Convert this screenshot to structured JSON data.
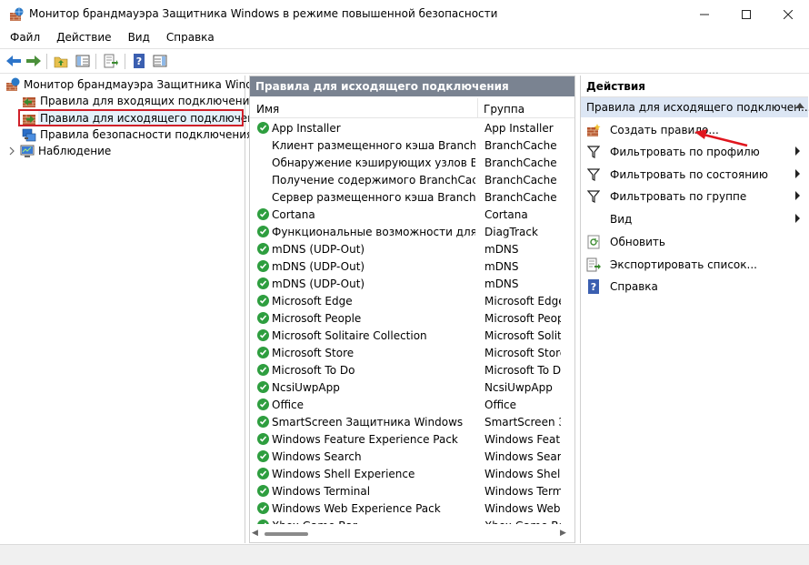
{
  "window": {
    "title": "Монитор брандмауэра Защитника Windows в режиме повышенной безопасности",
    "minimize": "—",
    "maximize": "☐",
    "close": "✕"
  },
  "menu": [
    "Файл",
    "Действие",
    "Вид",
    "Справка"
  ],
  "toolbar": {
    "icons": [
      "back-arrow-icon",
      "forward-arrow-icon",
      "folder-up-icon",
      "show-hide-tree-icon",
      "export-list-icon",
      "help-icon",
      "show-hide-action-pane-icon"
    ]
  },
  "tree": {
    "root": "Монитор брандмауэра Защитника Windows",
    "items": [
      "Правила для входящих подключений",
      "Правила для исходящего подключения",
      "Правила безопасности подключения",
      "Наблюдение"
    ]
  },
  "middle": {
    "header": "Правила для исходящего подключения",
    "columns": [
      "Имя",
      "Группа"
    ],
    "rows": [
      {
        "name": "App Installer",
        "group": "App Installer",
        "enabled": true
      },
      {
        "name": "Клиент размещенного кэша BranchCac...",
        "group": "BranchCache - ",
        "enabled": false
      },
      {
        "name": "Обнаружение кэширующих узлов Bra...",
        "group": "BranchCache - ",
        "enabled": false
      },
      {
        "name": "Получение содержимого BranchCache ...",
        "group": "BranchCache - ",
        "enabled": false
      },
      {
        "name": "Сервер размещенного кэша BranchCac...",
        "group": "BranchCache - ",
        "enabled": false
      },
      {
        "name": "Cortana",
        "group": "Cortana",
        "enabled": true
      },
      {
        "name": "Функциональные возможности для по...",
        "group": "DiagTrack",
        "enabled": true
      },
      {
        "name": "mDNS (UDP-Out)",
        "group": "mDNS",
        "enabled": true
      },
      {
        "name": "mDNS (UDP-Out)",
        "group": "mDNS",
        "enabled": true
      },
      {
        "name": "mDNS (UDP-Out)",
        "group": "mDNS",
        "enabled": true
      },
      {
        "name": "Microsoft Edge",
        "group": "Microsoft Edge",
        "enabled": true
      },
      {
        "name": "Microsoft People",
        "group": "Microsoft Peopl",
        "enabled": true
      },
      {
        "name": "Microsoft Solitaire Collection",
        "group": "Microsoft Solita",
        "enabled": true
      },
      {
        "name": "Microsoft Store",
        "group": "Microsoft Store",
        "enabled": true
      },
      {
        "name": "Microsoft To Do",
        "group": "Microsoft To Do",
        "enabled": true
      },
      {
        "name": "NcsiUwpApp",
        "group": "NcsiUwpApp",
        "enabled": true
      },
      {
        "name": "Office",
        "group": "Office",
        "enabled": true
      },
      {
        "name": "SmartScreen Защитника Windows",
        "group": "SmartScreen За",
        "enabled": true
      },
      {
        "name": "Windows Feature Experience Pack",
        "group": "Windows Featur",
        "enabled": true
      },
      {
        "name": "Windows Search",
        "group": "Windows Search",
        "enabled": true
      },
      {
        "name": "Windows Shell Experience",
        "group": "Windows Shell E",
        "enabled": true
      },
      {
        "name": "Windows Terminal",
        "group": "Windows Termi",
        "enabled": true
      },
      {
        "name": "Windows Web Experience Pack",
        "group": "Windows Web E",
        "enabled": true
      },
      {
        "name": "Xbox Game Bar",
        "group": "Xbox Game Bar",
        "enabled": true
      }
    ]
  },
  "actions": {
    "header": "Действия",
    "section": "Правила для исходящего подключен...",
    "items": [
      {
        "label": "Создать правило...",
        "icon": "new-rule-icon",
        "submenu": false
      },
      {
        "label": "Фильтровать по профилю",
        "icon": "filter-icon",
        "submenu": true
      },
      {
        "label": "Фильтровать по состоянию",
        "icon": "filter-icon",
        "submenu": true
      },
      {
        "label": "Фильтровать по группе",
        "icon": "filter-icon",
        "submenu": true
      },
      {
        "label": "Вид",
        "icon": "",
        "submenu": true
      },
      {
        "label": "Обновить",
        "icon": "refresh-icon",
        "submenu": false
      },
      {
        "label": "Экспортировать список...",
        "icon": "export-list-icon",
        "submenu": false
      },
      {
        "label": "Справка",
        "icon": "help-icon",
        "submenu": false
      }
    ]
  },
  "colors": {
    "pane_header_bg": "#7a8391",
    "action_section_bg": "#dce6f4",
    "enabled_check": "#2e9e3f",
    "highlight_box": "#d0202a",
    "annotation_arrow": "#e0161e"
  }
}
